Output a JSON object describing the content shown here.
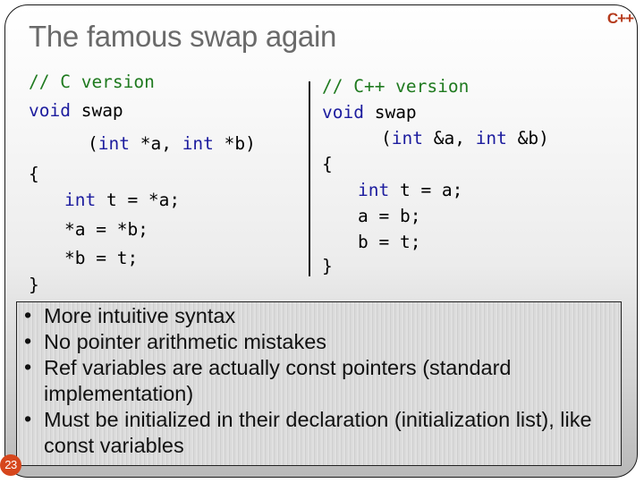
{
  "slide": {
    "title": "The famous swap again",
    "logo": "C++",
    "slide_number": "23",
    "c_version": {
      "comment": "// C version",
      "sig_kw": "void",
      "sig_name": " swap",
      "params_open": "(",
      "param1_kw": "int",
      "param1_rest": " *a, ",
      "param2_kw": "int",
      "param2_rest": " *b)",
      "open_brace": "{",
      "body1_kw": "int",
      "body1_rest": " t = *a;",
      "body2": "*a = *b;",
      "body3": "*b = t;",
      "close_brace": "}"
    },
    "cpp_version": {
      "comment": "// C++ version",
      "sig_kw": "void",
      "sig_name": " swap",
      "params_open": "(",
      "param1_kw": "int",
      "param1_rest": " &a, ",
      "param2_kw": "int",
      "param2_rest": " &b)",
      "open_brace": "{",
      "body1_kw": "int",
      "body1_rest": " t = a;",
      "body2": "a = b;",
      "body3": "b = t;",
      "close_brace": "}"
    },
    "bullet_marker": "•",
    "bullets": [
      "More intuitive syntax",
      "No pointer arithmetic mistakes",
      "Ref variables are actually const pointers (standard implementation)",
      "Must be initialized in their declaration (initialization list), like const variables"
    ],
    "colors": {
      "comment": "#1f7a1f",
      "keyword": "#1c1c9e",
      "title": "#6a6a6a",
      "logo": "#b53a1c",
      "slide_number_badge": "#d6461c"
    }
  }
}
